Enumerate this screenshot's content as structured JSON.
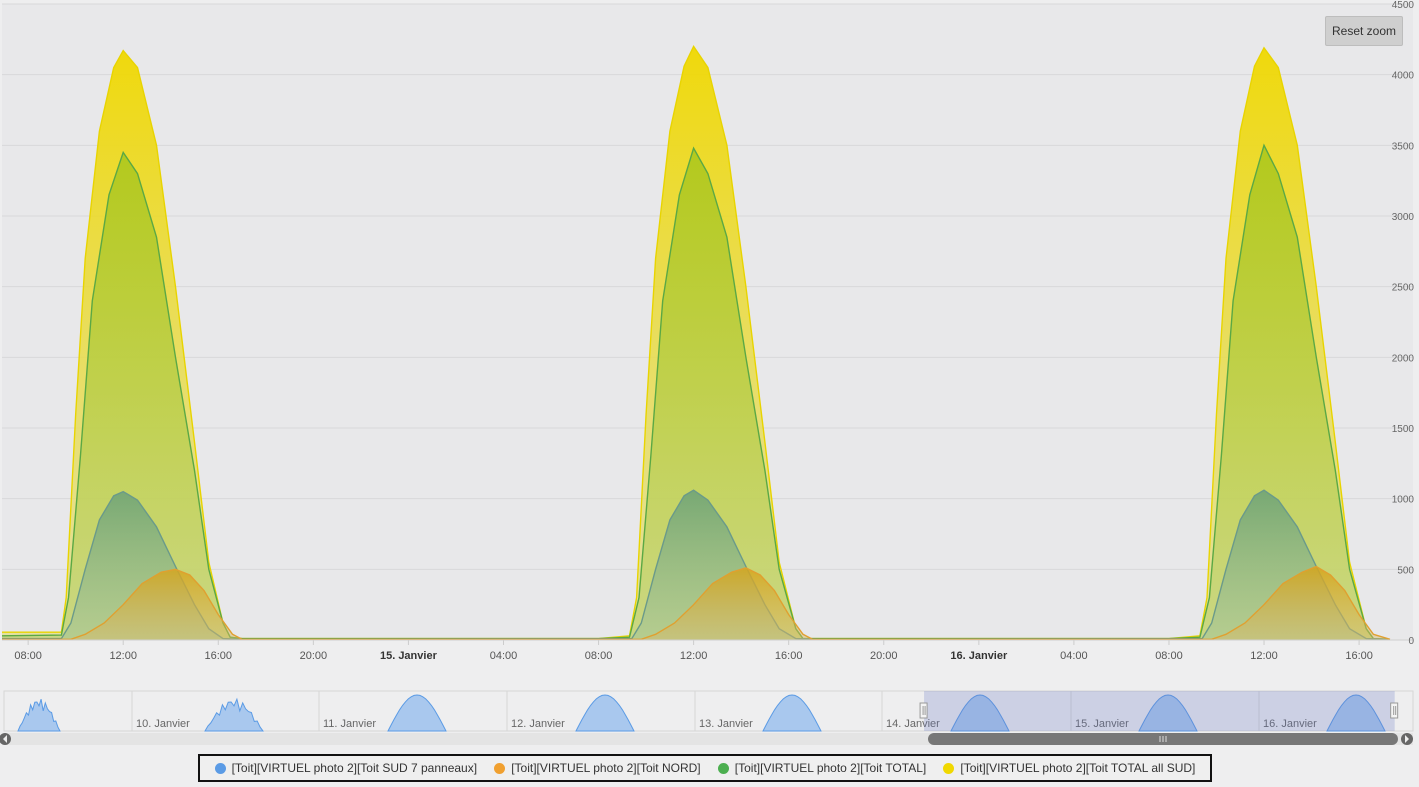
{
  "reset_zoom_label": "Reset zoom",
  "chart_data": {
    "type": "area",
    "x_unit": "hours since 14. Janvier 00:00",
    "xlim": [
      6.9,
      65.3
    ],
    "ylim": [
      0,
      4500
    ],
    "y_ticks": [
      0,
      500,
      1000,
      1500,
      2000,
      2500,
      3000,
      3500,
      4000,
      4500
    ],
    "y_tick_labels": [
      "0",
      "500",
      "1000",
      "1500",
      "2000",
      "2500",
      "3000",
      "3500",
      "4000",
      "4500"
    ],
    "x_ticks": [
      8,
      12,
      16,
      20,
      24,
      28,
      32,
      36,
      40,
      44,
      48,
      52,
      56,
      60,
      64
    ],
    "x_tick_labels": [
      "08:00",
      "12:00",
      "16:00",
      "20:00",
      "15. Janvier",
      "04:00",
      "08:00",
      "12:00",
      "16:00",
      "20:00",
      "16. Janvier",
      "04:00",
      "08:00",
      "12:00",
      "16:00"
    ],
    "x_tick_bold": [
      false,
      false,
      false,
      false,
      true,
      false,
      false,
      false,
      false,
      false,
      true,
      false,
      false,
      false,
      false
    ],
    "grid": true,
    "legend_position": "bottom",
    "series": [
      {
        "name": "[Toit][VIRTUEL photo 2][Toit TOTAL all SUD]",
        "color": "#e8d400",
        "points": [
          [
            6.9,
            55
          ],
          [
            9.4,
            55
          ],
          [
            9.6,
            300
          ],
          [
            10.0,
            1600
          ],
          [
            10.4,
            2700
          ],
          [
            11.0,
            3600
          ],
          [
            11.6,
            4050
          ],
          [
            12.0,
            4170
          ],
          [
            12.6,
            4050
          ],
          [
            13.4,
            3500
          ],
          [
            14.2,
            2500
          ],
          [
            15.0,
            1400
          ],
          [
            15.6,
            550
          ],
          [
            16.2,
            120
          ],
          [
            16.5,
            20
          ],
          [
            17.0,
            10
          ],
          [
            32.0,
            10
          ],
          [
            33.3,
            30
          ],
          [
            33.6,
            300
          ],
          [
            34.0,
            1600
          ],
          [
            34.4,
            2700
          ],
          [
            35.0,
            3600
          ],
          [
            35.6,
            4060
          ],
          [
            36.0,
            4200
          ],
          [
            36.6,
            4050
          ],
          [
            37.4,
            3500
          ],
          [
            38.2,
            2500
          ],
          [
            39.0,
            1400
          ],
          [
            39.6,
            550
          ],
          [
            40.3,
            80
          ],
          [
            40.6,
            10
          ],
          [
            41.5,
            10
          ],
          [
            56.0,
            10
          ],
          [
            57.3,
            30
          ],
          [
            57.6,
            300
          ],
          [
            58.0,
            1600
          ],
          [
            58.4,
            2700
          ],
          [
            59.0,
            3600
          ],
          [
            59.6,
            4060
          ],
          [
            60.0,
            4190
          ],
          [
            60.6,
            4050
          ],
          [
            61.4,
            3500
          ],
          [
            62.2,
            2500
          ],
          [
            63.0,
            1400
          ],
          [
            63.6,
            550
          ],
          [
            64.3,
            80
          ],
          [
            64.6,
            10
          ],
          [
            65.3,
            5
          ]
        ]
      },
      {
        "name": "[Toit][VIRTUEL photo 2][Toit TOTAL]",
        "color": "#5aa845",
        "points": [
          [
            6.9,
            30
          ],
          [
            9.4,
            35
          ],
          [
            9.7,
            300
          ],
          [
            10.2,
            1300
          ],
          [
            10.7,
            2400
          ],
          [
            11.4,
            3150
          ],
          [
            12.0,
            3450
          ],
          [
            12.6,
            3300
          ],
          [
            13.4,
            2850
          ],
          [
            14.2,
            2000
          ],
          [
            15.0,
            1200
          ],
          [
            15.6,
            500
          ],
          [
            16.2,
            120
          ],
          [
            16.5,
            20
          ],
          [
            17.0,
            10
          ],
          [
            32.0,
            10
          ],
          [
            33.3,
            20
          ],
          [
            33.7,
            300
          ],
          [
            34.2,
            1300
          ],
          [
            34.7,
            2400
          ],
          [
            35.4,
            3150
          ],
          [
            36.0,
            3480
          ],
          [
            36.6,
            3300
          ],
          [
            37.4,
            2850
          ],
          [
            38.2,
            2000
          ],
          [
            39.0,
            1200
          ],
          [
            39.6,
            500
          ],
          [
            40.3,
            80
          ],
          [
            40.6,
            10
          ],
          [
            41.5,
            10
          ],
          [
            56.0,
            10
          ],
          [
            57.3,
            20
          ],
          [
            57.7,
            300
          ],
          [
            58.2,
            1300
          ],
          [
            58.7,
            2400
          ],
          [
            59.4,
            3150
          ],
          [
            60.0,
            3500
          ],
          [
            60.6,
            3300
          ],
          [
            61.4,
            2850
          ],
          [
            62.2,
            2000
          ],
          [
            63.0,
            1200
          ],
          [
            63.6,
            500
          ],
          [
            64.3,
            80
          ],
          [
            64.6,
            10
          ],
          [
            65.3,
            5
          ]
        ]
      },
      {
        "name": "[Toit][VIRTUEL photo 2][Toit SUD 7 panneaux]",
        "color": "#6a9a8a",
        "points": [
          [
            6.9,
            10
          ],
          [
            9.4,
            10
          ],
          [
            9.8,
            120
          ],
          [
            10.4,
            500
          ],
          [
            11.0,
            850
          ],
          [
            11.6,
            1020
          ],
          [
            12.0,
            1050
          ],
          [
            12.6,
            990
          ],
          [
            13.4,
            800
          ],
          [
            14.2,
            520
          ],
          [
            15.0,
            250
          ],
          [
            15.6,
            80
          ],
          [
            16.2,
            10
          ],
          [
            17.0,
            5
          ],
          [
            33.4,
            10
          ],
          [
            33.8,
            120
          ],
          [
            34.4,
            500
          ],
          [
            35.0,
            850
          ],
          [
            35.6,
            1020
          ],
          [
            36.0,
            1060
          ],
          [
            36.6,
            990
          ],
          [
            37.4,
            800
          ],
          [
            38.2,
            520
          ],
          [
            39.0,
            250
          ],
          [
            39.6,
            80
          ],
          [
            40.3,
            10
          ],
          [
            41.5,
            5
          ],
          [
            57.4,
            10
          ],
          [
            57.8,
            120
          ],
          [
            58.4,
            500
          ],
          [
            59.0,
            850
          ],
          [
            59.6,
            1020
          ],
          [
            60.0,
            1060
          ],
          [
            60.6,
            990
          ],
          [
            61.4,
            800
          ],
          [
            62.2,
            520
          ],
          [
            63.0,
            250
          ],
          [
            63.6,
            80
          ],
          [
            64.3,
            10
          ],
          [
            65.3,
            5
          ]
        ]
      },
      {
        "name": "[Toit][VIRTUEL photo 2][Toit NORD]",
        "color": "#e0a030",
        "points": [
          [
            6.9,
            5
          ],
          [
            9.8,
            5
          ],
          [
            10.4,
            40
          ],
          [
            11.2,
            120
          ],
          [
            12.0,
            250
          ],
          [
            12.8,
            400
          ],
          [
            13.6,
            480
          ],
          [
            14.2,
            500
          ],
          [
            14.8,
            460
          ],
          [
            15.4,
            350
          ],
          [
            16.0,
            180
          ],
          [
            16.6,
            40
          ],
          [
            17.0,
            5
          ],
          [
            33.8,
            5
          ],
          [
            34.4,
            40
          ],
          [
            35.2,
            120
          ],
          [
            36.0,
            250
          ],
          [
            36.8,
            400
          ],
          [
            37.6,
            480
          ],
          [
            38.2,
            510
          ],
          [
            38.8,
            460
          ],
          [
            39.4,
            350
          ],
          [
            40.0,
            180
          ],
          [
            40.6,
            40
          ],
          [
            41.0,
            5
          ],
          [
            57.8,
            5
          ],
          [
            58.4,
            40
          ],
          [
            59.2,
            120
          ],
          [
            60.0,
            250
          ],
          [
            60.8,
            400
          ],
          [
            61.6,
            480
          ],
          [
            62.2,
            520
          ],
          [
            62.8,
            460
          ],
          [
            63.4,
            350
          ],
          [
            64.0,
            180
          ],
          [
            64.6,
            40
          ],
          [
            65.3,
            5
          ]
        ]
      }
    ]
  },
  "navigator": {
    "labels": [
      "10. Janvier",
      "11. Janvier",
      "12. Janvier",
      "13. Janvier",
      "14. Janvier",
      "15. Janvier",
      "16. Janvier"
    ],
    "selection_start_fraction": 0.653,
    "selection_end_fraction": 0.987
  },
  "legend": {
    "items": [
      {
        "label": "[Toit][VIRTUEL photo 2][Toit SUD 7 panneaux]",
        "color": "#5b9be5"
      },
      {
        "label": "[Toit][VIRTUEL photo 2][Toit NORD]",
        "color": "#f0a030"
      },
      {
        "label": "[Toit][VIRTUEL photo 2][Toit TOTAL]",
        "color": "#4caf50"
      },
      {
        "label": "[Toit][VIRTUEL photo 2][Toit TOTAL all SUD]",
        "color": "#f0d800"
      }
    ]
  }
}
